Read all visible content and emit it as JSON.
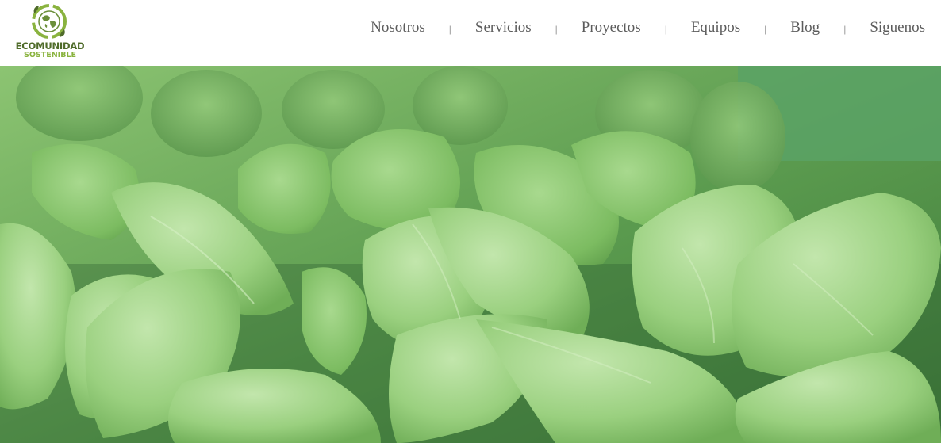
{
  "logo": {
    "line1": "ECOMUNIDAD",
    "line2": "SOSTENIBLE",
    "colors": {
      "dark": "#4f6b2a",
      "light": "#8ab33f"
    }
  },
  "nav": {
    "items": [
      "Nosotros",
      "Servicios",
      "Proyectos",
      "Equipos",
      "Blog",
      "Siguenos"
    ],
    "separator": "|"
  },
  "hero": {
    "image": "green-seedling-leaves-photo",
    "colors": {
      "leaf_light": "#a6d98b",
      "leaf_mid": "#7dbf5f",
      "leaf_dark": "#3f7a3a",
      "background": "#55a05f"
    }
  }
}
